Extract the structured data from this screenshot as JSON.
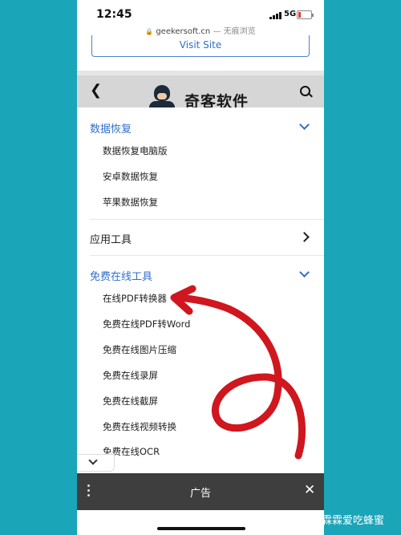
{
  "status_bar": {
    "time": "12:45",
    "network": "5G"
  },
  "browser": {
    "url": "geekersoft.cn",
    "mode_label": "— 无痕浏览",
    "visit_button": "Visit Site"
  },
  "site_header": {
    "logo_text": "奇客软件"
  },
  "menu": {
    "sections": [
      {
        "title": "数据恢复",
        "items": [
          "数据恢复电脑版",
          "安卓数据恢复",
          "苹果数据恢复"
        ]
      },
      {
        "title": "应用工具"
      },
      {
        "title": "免费在线工具",
        "items": [
          "在线PDF转换器",
          "免费在线PDF转Word",
          "免费在线图片压缩",
          "免费在线录屏",
          "免费在线截屏",
          "免费在线视频转换",
          "免费在线OCR"
        ]
      }
    ]
  },
  "ad_bar": {
    "label": "广告"
  },
  "watermark": {
    "text": "旅行的霖霖爱吃蜂蜜"
  },
  "colors": {
    "accent": "#2f6fcd",
    "background": "#1aa5b8",
    "annotation": "#d0161e"
  }
}
